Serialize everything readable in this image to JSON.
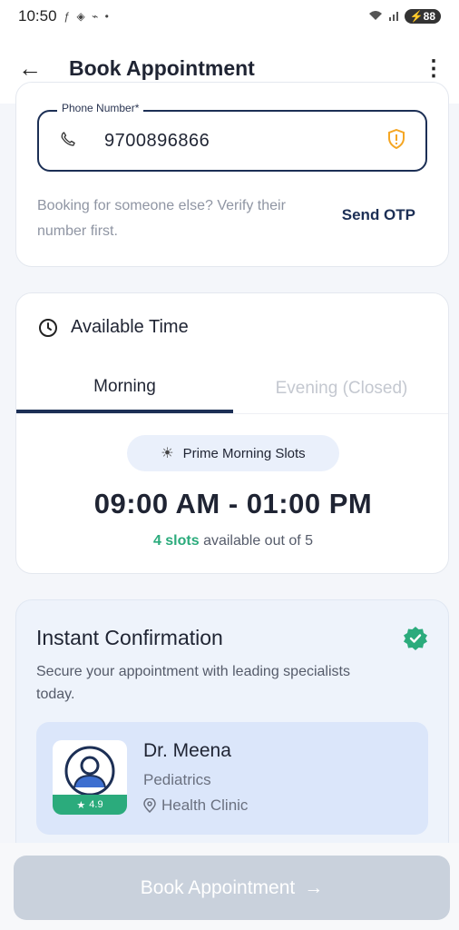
{
  "status_bar": {
    "time": "10:50",
    "battery": "88"
  },
  "app_bar": {
    "title": "Book Appointment",
    "back_icon": "arrow-left-icon",
    "more_icon": "more-vertical-icon"
  },
  "phone": {
    "label": "Phone Number*",
    "value": "9700896866",
    "helper_text": "Booking for someone else? Verify their number first.",
    "send_otp_label": "Send OTP"
  },
  "time_card": {
    "title": "Available Time",
    "tabs": [
      {
        "label": "Morning",
        "active": true
      },
      {
        "label": "Evening (Closed)",
        "active": false
      }
    ],
    "prime_label": "Prime Morning Slots",
    "time_range": "09:00 AM - 01:00 PM",
    "slots_count": "4 slots",
    "slots_rest": "available out of 5"
  },
  "confirmation": {
    "title": "Instant Confirmation",
    "subtitle": "Secure your appointment with leading specialists today.",
    "doctor": {
      "name": "Dr. Meena",
      "specialty": "Pediatrics",
      "location": "Health Clinic",
      "rating": "4.9"
    }
  },
  "footer": {
    "book_label": "Book Appointment"
  },
  "colors": {
    "primary": "#1c2f55",
    "accent_green": "#2bab7c",
    "amber": "#f5a623",
    "disabled_button": "#c9d1dc"
  }
}
